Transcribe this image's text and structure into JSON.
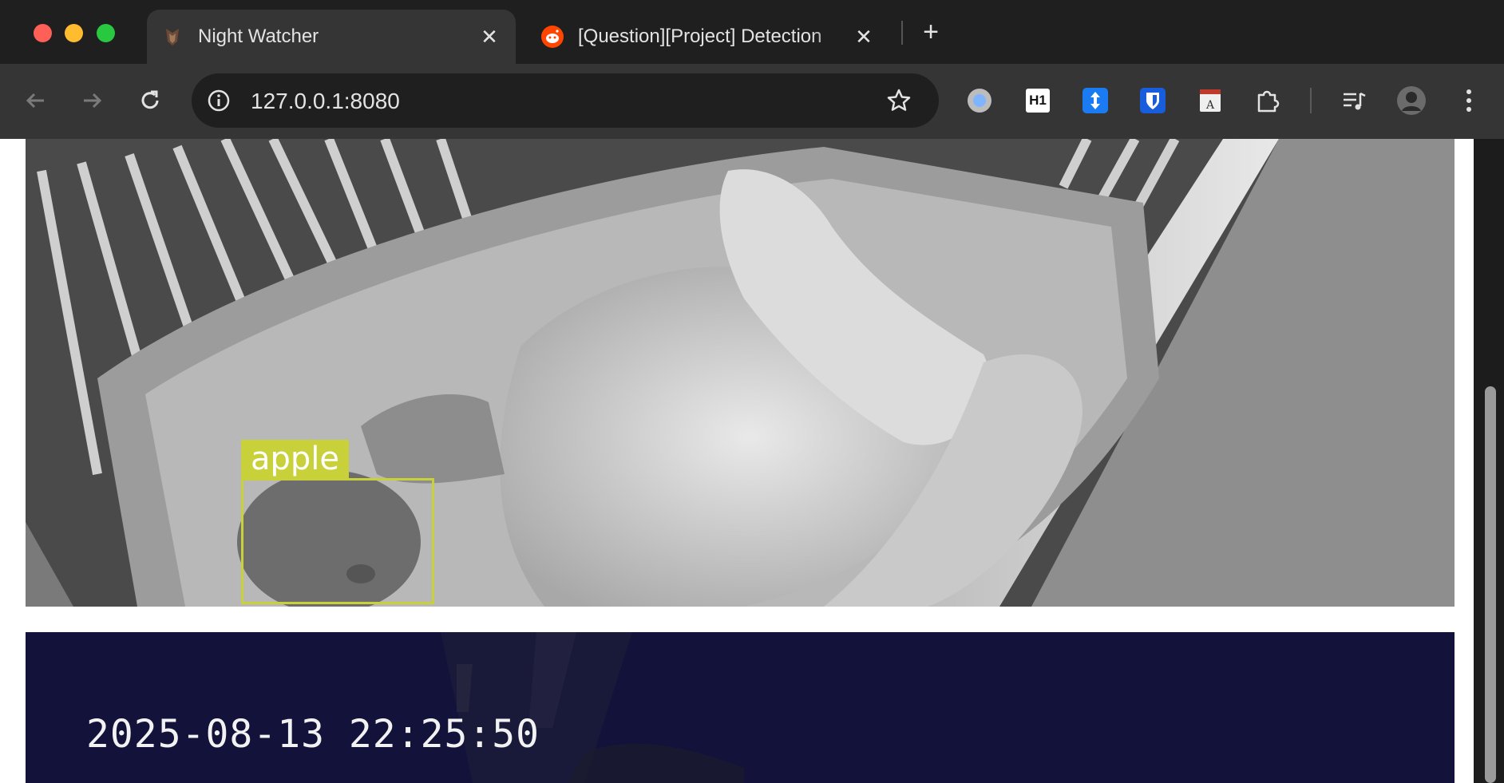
{
  "browser": {
    "tabs": [
      {
        "title": "Night Watcher",
        "active": true,
        "favicon": "owl-favicon-icon"
      },
      {
        "title": "[Question][Project] Detection",
        "active": false,
        "favicon": "reddit-favicon-icon"
      }
    ],
    "address_bar": {
      "url": "127.0.0.1:8080"
    },
    "extensions": [
      "circle-extension-icon",
      "h1-extension-icon",
      "arrows-extension-icon",
      "bitwarden-shield-icon",
      "dictionary-extension-icon",
      "puzzle-extensions-icon",
      "media-controls-icon",
      "profile-avatar-icon",
      "more-menu-icon"
    ],
    "h1_badge": "H1"
  },
  "page": {
    "feeds": [
      {
        "detection": {
          "label": "apple",
          "color": "#c9d13a"
        }
      },
      {
        "timestamp": "2025-08-13 22:25:50"
      }
    ]
  }
}
